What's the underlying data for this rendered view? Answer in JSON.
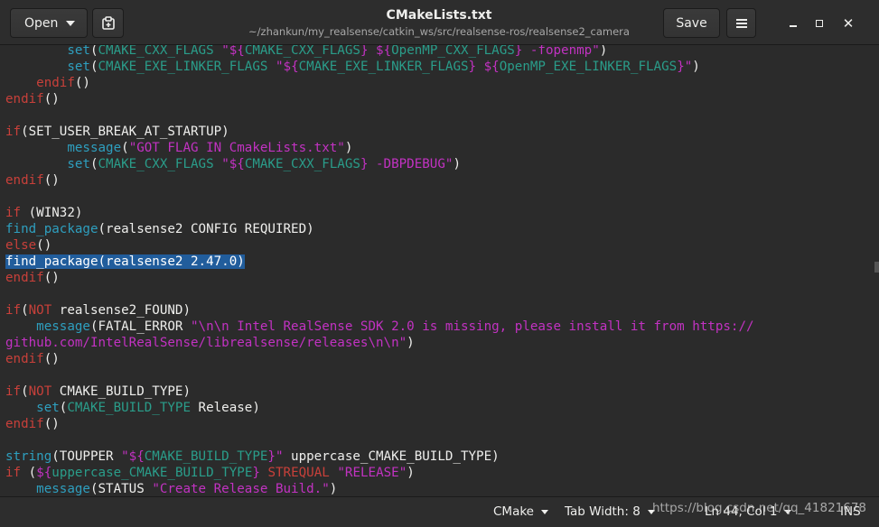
{
  "header": {
    "open_label": "Open",
    "save_label": "Save",
    "title": "CMakeLists.txt",
    "subtitle": "~/zhankun/my_realsense/catkin_ws/src/realsense-ros/realsense2_camera"
  },
  "icons": {
    "new_document": "new-document-icon",
    "menu": "hamburger-menu-icon",
    "minimize": "minimize-icon",
    "maximize": "maximize-icon",
    "close": "close-icon"
  },
  "editor": {
    "lines": [
      [
        {
          "t": "        "
        },
        {
          "t": "set",
          "c": "f"
        },
        {
          "t": "("
        },
        {
          "t": "CMAKE_CXX_FLAGS",
          "c": "v"
        },
        {
          "t": " "
        },
        {
          "t": "\"${",
          "c": "s"
        },
        {
          "t": "CMAKE_CXX_FLAGS",
          "c": "v"
        },
        {
          "t": "}",
          "c": "s"
        },
        {
          "t": " "
        },
        {
          "t": "${",
          "c": "s"
        },
        {
          "t": "OpenMP_CXX_FLAGS",
          "c": "v"
        },
        {
          "t": "} -fopenmp\"",
          "c": "s"
        },
        {
          "t": ")"
        }
      ],
      [
        {
          "t": "        "
        },
        {
          "t": "set",
          "c": "f"
        },
        {
          "t": "("
        },
        {
          "t": "CMAKE_EXE_LINKER_FLAGS",
          "c": "v"
        },
        {
          "t": " "
        },
        {
          "t": "\"${",
          "c": "s"
        },
        {
          "t": "CMAKE_EXE_LINKER_FLAGS",
          "c": "v"
        },
        {
          "t": "}",
          "c": "s"
        },
        {
          "t": " "
        },
        {
          "t": "${",
          "c": "s"
        },
        {
          "t": "OpenMP_EXE_LINKER_FLAGS",
          "c": "v"
        },
        {
          "t": "}\"",
          "c": "s"
        },
        {
          "t": ")"
        }
      ],
      [
        {
          "t": "    "
        },
        {
          "t": "endif",
          "c": "k"
        },
        {
          "t": "()"
        }
      ],
      [
        {
          "t": "endif",
          "c": "k"
        },
        {
          "t": "()"
        }
      ],
      [
        {
          "t": ""
        }
      ],
      [
        {
          "t": "if",
          "c": "k"
        },
        {
          "t": "(SET_USER_BREAK_AT_STARTUP)"
        }
      ],
      [
        {
          "t": "        "
        },
        {
          "t": "message",
          "c": "f"
        },
        {
          "t": "("
        },
        {
          "t": "\"GOT FLAG IN CmakeLists.txt\"",
          "c": "s"
        },
        {
          "t": ")"
        }
      ],
      [
        {
          "t": "        "
        },
        {
          "t": "set",
          "c": "f"
        },
        {
          "t": "("
        },
        {
          "t": "CMAKE_CXX_FLAGS",
          "c": "v"
        },
        {
          "t": " "
        },
        {
          "t": "\"${",
          "c": "s"
        },
        {
          "t": "CMAKE_CXX_FLAGS",
          "c": "v"
        },
        {
          "t": "} -DBPDEBUG\"",
          "c": "s"
        },
        {
          "t": ")"
        }
      ],
      [
        {
          "t": "endif",
          "c": "k"
        },
        {
          "t": "()"
        }
      ],
      [
        {
          "t": ""
        }
      ],
      [
        {
          "t": "if",
          "c": "k"
        },
        {
          "t": " (WIN32)"
        }
      ],
      [
        {
          "t": "find_package",
          "c": "f"
        },
        {
          "t": "(realsense2 CONFIG REQUIRED)"
        }
      ],
      [
        {
          "t": "else",
          "c": "k"
        },
        {
          "t": "()"
        }
      ],
      [
        {
          "t": "find_package(realsense2 2.47.0)",
          "c": "hl"
        }
      ],
      [
        {
          "t": "endif",
          "c": "k"
        },
        {
          "t": "()"
        }
      ],
      [
        {
          "t": ""
        }
      ],
      [
        {
          "t": "if",
          "c": "k"
        },
        {
          "t": "("
        },
        {
          "t": "NOT",
          "c": "k"
        },
        {
          "t": " realsense2_FOUND)"
        }
      ],
      [
        {
          "t": "    "
        },
        {
          "t": "message",
          "c": "f"
        },
        {
          "t": "(FATAL_ERROR "
        },
        {
          "t": "\"\\n\\n Intel RealSense SDK 2.0 is missing, please install it from https://",
          "c": "s"
        }
      ],
      [
        {
          "t": "github.com/IntelRealSense/librealsense/releases\\n\\n\"",
          "c": "s"
        },
        {
          "t": ")"
        }
      ],
      [
        {
          "t": "endif",
          "c": "k"
        },
        {
          "t": "()"
        }
      ],
      [
        {
          "t": ""
        }
      ],
      [
        {
          "t": "if",
          "c": "k"
        },
        {
          "t": "("
        },
        {
          "t": "NOT",
          "c": "k"
        },
        {
          "t": " CMAKE_BUILD_TYPE)"
        }
      ],
      [
        {
          "t": "    "
        },
        {
          "t": "set",
          "c": "f"
        },
        {
          "t": "("
        },
        {
          "t": "CMAKE_BUILD_TYPE",
          "c": "v"
        },
        {
          "t": " Release)"
        }
      ],
      [
        {
          "t": "endif",
          "c": "k"
        },
        {
          "t": "()"
        }
      ],
      [
        {
          "t": ""
        }
      ],
      [
        {
          "t": "string",
          "c": "f"
        },
        {
          "t": "(TOUPPER "
        },
        {
          "t": "\"${",
          "c": "s"
        },
        {
          "t": "CMAKE_BUILD_TYPE",
          "c": "v"
        },
        {
          "t": "}\"",
          "c": "s"
        },
        {
          "t": " uppercase_CMAKE_BUILD_TYPE)"
        }
      ],
      [
        {
          "t": "if",
          "c": "k"
        },
        {
          "t": " ("
        },
        {
          "t": "${",
          "c": "s"
        },
        {
          "t": "uppercase_CMAKE_BUILD_TYPE",
          "c": "v"
        },
        {
          "t": "}",
          "c": "s"
        },
        {
          "t": " "
        },
        {
          "t": "STREQUAL",
          "c": "k"
        },
        {
          "t": " "
        },
        {
          "t": "\"RELEASE\"",
          "c": "s"
        },
        {
          "t": ")"
        }
      ],
      [
        {
          "t": "    "
        },
        {
          "t": "message",
          "c": "f"
        },
        {
          "t": "(STATUS "
        },
        {
          "t": "\"Create Release Build.\"",
          "c": "s"
        },
        {
          "t": ")"
        }
      ]
    ]
  },
  "status": {
    "language": "CMake",
    "tab_width": "Tab Width: 8",
    "position": "Ln 44, Col 1",
    "mode": "INS"
  },
  "watermark": "https://blog.csdn.net/qq_41821678"
}
